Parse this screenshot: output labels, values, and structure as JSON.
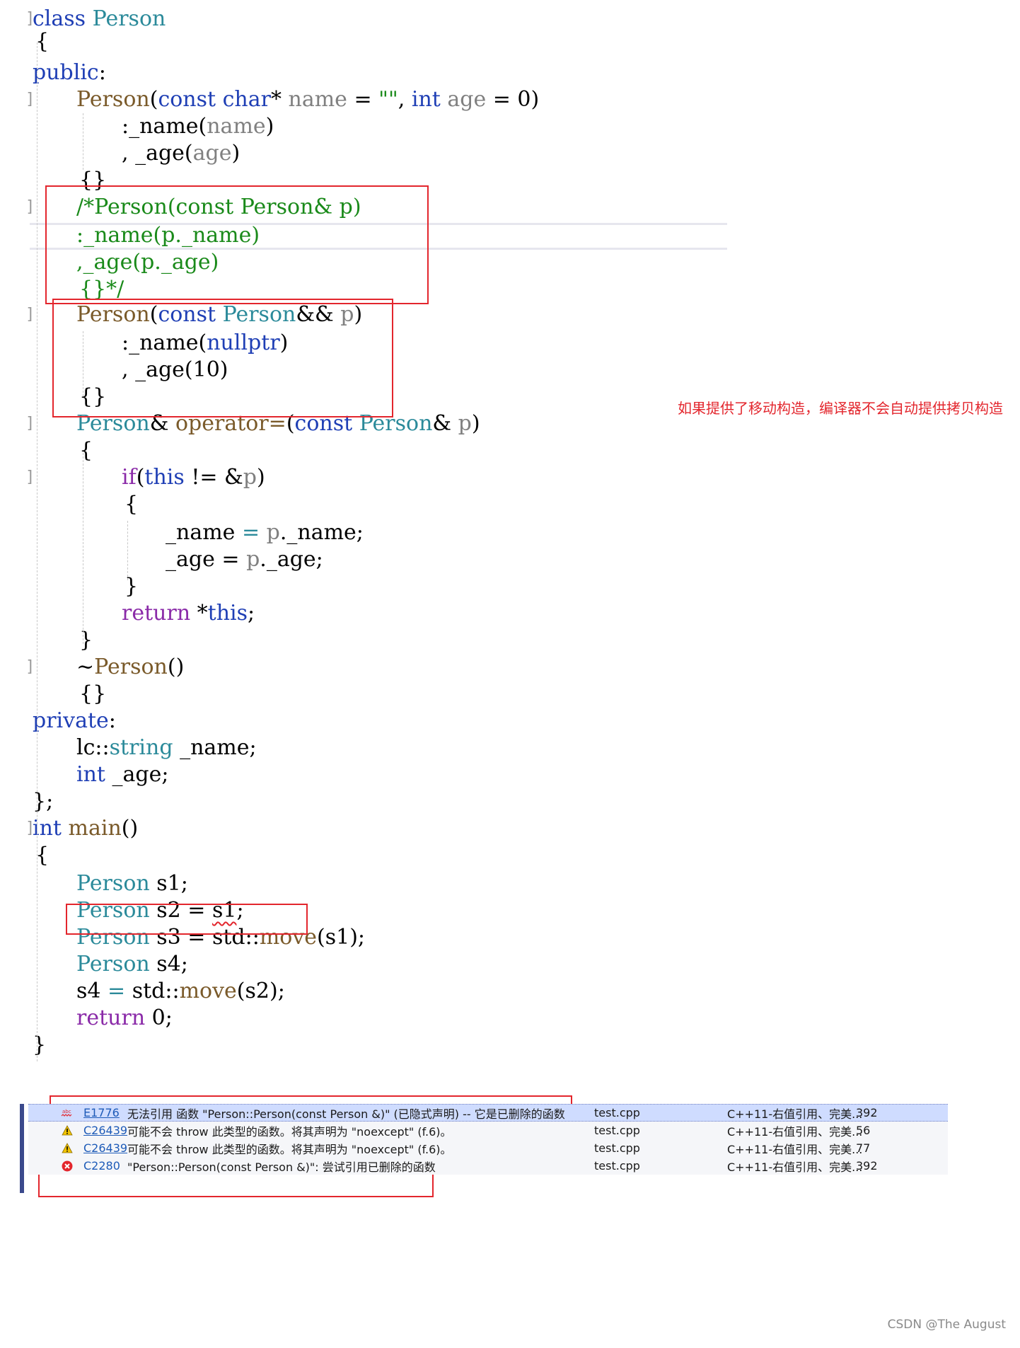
{
  "colors": {
    "keyword": "#1f3fb5",
    "type": "#2b8a9a",
    "func": "#7a5a2a",
    "comment": "#1a8a1a",
    "param": "#808080",
    "plain": "#000000",
    "purple": "#8a2aa8",
    "highlight": "#e3262d"
  },
  "code_lines": [
    {
      "t": [
        [
          "class ",
          "keyword"
        ],
        [
          "Person",
          "type"
        ]
      ]
    },
    {
      "t": [
        [
          "{",
          "plain"
        ]
      ]
    },
    {
      "t": [
        [
          "public",
          "keyword"
        ],
        [
          ":",
          "plain"
        ]
      ]
    },
    {
      "t": [
        [
          "Person",
          "func"
        ],
        [
          "(",
          "plain"
        ],
        [
          "const ",
          "keyword"
        ],
        [
          "char",
          "keyword"
        ],
        [
          "* ",
          "plain"
        ],
        [
          "name",
          "param"
        ],
        [
          " = ",
          "plain"
        ],
        [
          "\"\"",
          "comment"
        ],
        [
          ", ",
          "plain"
        ],
        [
          "int ",
          "keyword"
        ],
        [
          "age",
          "param"
        ],
        [
          " = 0)",
          "plain"
        ]
      ]
    },
    {
      "t": [
        [
          ":_name(",
          "plain"
        ],
        [
          "name",
          "param"
        ],
        [
          ")",
          "plain"
        ]
      ]
    },
    {
      "t": [
        [
          ", _age(",
          "plain"
        ],
        [
          "age",
          "param"
        ],
        [
          ")",
          "plain"
        ]
      ]
    },
    {
      "t": [
        [
          "{}",
          "plain"
        ]
      ]
    },
    {
      "t": [
        [
          "/*Person(const Person& p)",
          "comment"
        ]
      ]
    },
    {
      "t": [
        [
          ":_name(p._name)",
          "comment"
        ]
      ]
    },
    {
      "t": [
        [
          ",_age(p._age)",
          "comment"
        ]
      ]
    },
    {
      "t": [
        [
          "{}*/",
          "comment"
        ]
      ]
    },
    {
      "t": [
        [
          "Person",
          "func"
        ],
        [
          "(",
          "plain"
        ],
        [
          "const ",
          "keyword"
        ],
        [
          "Person",
          "type"
        ],
        [
          "&& ",
          "plain"
        ],
        [
          "p",
          "param"
        ],
        [
          ")",
          "plain"
        ]
      ]
    },
    {
      "t": [
        [
          ":_name(",
          "plain"
        ],
        [
          "nullptr",
          "keyword"
        ],
        [
          ")",
          "plain"
        ]
      ]
    },
    {
      "t": [
        [
          ", _age(10)",
          "plain"
        ]
      ]
    },
    {
      "t": [
        [
          "{}",
          "plain"
        ]
      ]
    },
    {
      "t": [
        [
          "Person",
          "type"
        ],
        [
          "& ",
          "plain"
        ],
        [
          "operator=",
          "func"
        ],
        [
          "(",
          "plain"
        ],
        [
          "const ",
          "keyword"
        ],
        [
          "Person",
          "type"
        ],
        [
          "& ",
          "plain"
        ],
        [
          "p",
          "param"
        ],
        [
          ")",
          "plain"
        ]
      ]
    },
    {
      "t": [
        [
          "{",
          "plain"
        ]
      ]
    },
    {
      "t": [
        [
          "if",
          "purple"
        ],
        [
          "(",
          "plain"
        ],
        [
          "this",
          "keyword"
        ],
        [
          " != &",
          "plain"
        ],
        [
          "p",
          "param"
        ],
        [
          ")",
          "plain"
        ]
      ]
    },
    {
      "t": [
        [
          "{",
          "plain"
        ]
      ]
    },
    {
      "t": [
        [
          "_name ",
          "plain"
        ],
        [
          "=",
          "type"
        ],
        [
          " ",
          "plain"
        ],
        [
          "p",
          "param"
        ],
        [
          "._name;",
          "plain"
        ]
      ]
    },
    {
      "t": [
        [
          "_age = ",
          "plain"
        ],
        [
          "p",
          "param"
        ],
        [
          "._age;",
          "plain"
        ]
      ]
    },
    {
      "t": [
        [
          "}",
          "plain"
        ]
      ]
    },
    {
      "t": [
        [
          "return ",
          "purple"
        ],
        [
          "*",
          "plain"
        ],
        [
          "this",
          "keyword"
        ],
        [
          ";",
          "plain"
        ]
      ]
    },
    {
      "t": [
        [
          "}",
          "plain"
        ]
      ]
    },
    {
      "t": [
        [
          "~",
          "plain"
        ],
        [
          "Person",
          "func"
        ],
        [
          "()",
          "plain"
        ]
      ]
    },
    {
      "t": [
        [
          "{}",
          "plain"
        ]
      ]
    },
    {
      "t": [
        [
          "private",
          "keyword"
        ],
        [
          ":",
          "plain"
        ]
      ]
    },
    {
      "t": [
        [
          "lc",
          "plain"
        ],
        [
          "::",
          "plain"
        ],
        [
          "string ",
          "type"
        ],
        [
          "_name;",
          "plain"
        ]
      ]
    },
    {
      "t": [
        [
          "int ",
          "keyword"
        ],
        [
          "_age;",
          "plain"
        ]
      ]
    },
    {
      "t": [
        [
          "};",
          "plain"
        ]
      ]
    },
    {
      "t": [
        [
          "int ",
          "keyword"
        ],
        [
          "main",
          "func"
        ],
        [
          "()",
          "plain"
        ]
      ]
    },
    {
      "t": [
        [
          "{",
          "plain"
        ]
      ]
    },
    {
      "t": [
        [
          "Person ",
          "type"
        ],
        [
          "s1;",
          "plain"
        ]
      ]
    },
    {
      "t": [
        [
          "Person ",
          "type"
        ],
        [
          "s2 = ",
          "plain"
        ],
        [
          "s1",
          "squiggle"
        ],
        [
          ";",
          "plain"
        ]
      ]
    },
    {
      "t": [
        [
          "Person ",
          "type"
        ],
        [
          "s3 = std::",
          "plain"
        ],
        [
          "move",
          "func"
        ],
        [
          "(s1);",
          "plain"
        ]
      ]
    },
    {
      "t": [
        [
          "Person ",
          "type"
        ],
        [
          "s4;",
          "plain"
        ]
      ]
    },
    {
      "t": [
        [
          "s4 ",
          "plain"
        ],
        [
          "=",
          "type"
        ],
        [
          " std::",
          "plain"
        ],
        [
          "move",
          "func"
        ],
        [
          "(s2);",
          "plain"
        ]
      ]
    },
    {
      "t": [
        [
          "return ",
          "purple"
        ],
        [
          "0;",
          "plain"
        ]
      ]
    },
    {
      "t": [
        [
          "}",
          "plain"
        ]
      ]
    }
  ],
  "annotation": "如果提供了移动构造，编译器不会自动提供拷贝构造",
  "errors": [
    {
      "icon": "spell-error-icon",
      "code": "E1776",
      "desc": "无法引用 函数 \"Person::Person(const Person &)\" (已隐式声明) -- 它是已删除的函数",
      "file": "test.cpp",
      "project": "C++11-右值引用、完美...",
      "line": "392"
    },
    {
      "icon": "warning-icon",
      "code": "C26439",
      "desc": "可能不会 throw 此类型的函数。将其声明为 \"noexcept\" (f.6)。",
      "file": "test.cpp",
      "project": "C++11-右值引用、完美...",
      "line": "56"
    },
    {
      "icon": "warning-icon",
      "code": "C26439",
      "desc": "可能不会 throw 此类型的函数。将其声明为 \"noexcept\" (f.6)。",
      "file": "test.cpp",
      "project": "C++11-右值引用、完美...",
      "line": "77"
    },
    {
      "icon": "error-icon",
      "code": "C2280",
      "desc": "\"Person::Person(const Person &)\": 尝试引用已删除的函数",
      "file": "test.cpp",
      "project": "C++11-右值引用、完美...",
      "line": "392"
    }
  ],
  "watermark": "CSDN @The    August"
}
